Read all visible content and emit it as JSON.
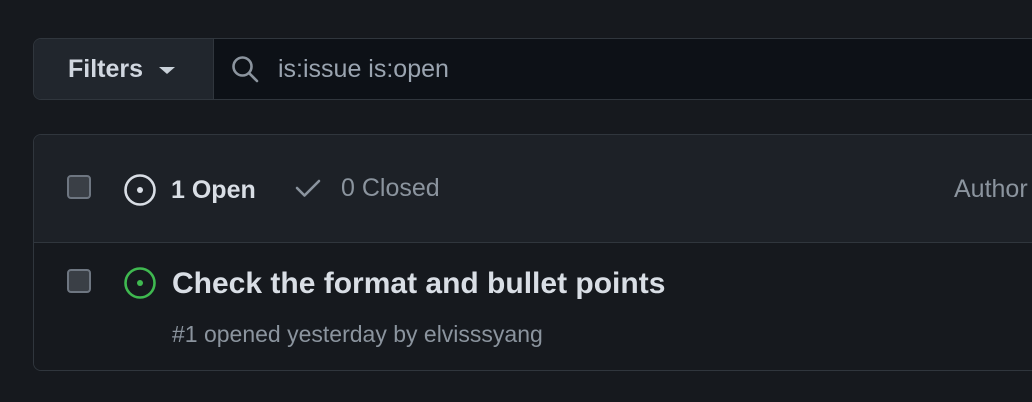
{
  "filter_bar": {
    "filters_label": "Filters",
    "search_value": "is:issue is:open"
  },
  "issues_header": {
    "open_label": "1 Open",
    "closed_label": "0 Closed",
    "author_label": "Author"
  },
  "issues": [
    {
      "title": "Check the format and bullet points",
      "meta": "#1 opened yesterday by elvisssyang",
      "status_color": "#3fb950"
    }
  ],
  "icons": {
    "filters_caret": "triangle-down-icon",
    "search": "search-icon",
    "open": "issue-opened-icon",
    "closed": "check-icon",
    "issue_status": "issue-opened-icon"
  },
  "colors": {
    "background": "#16191e",
    "open_issue": "#3fb950"
  }
}
